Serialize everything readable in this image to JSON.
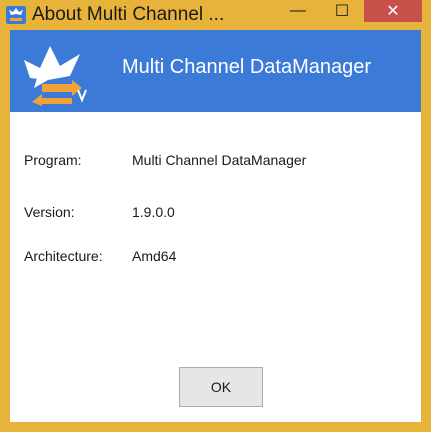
{
  "window": {
    "title": "About Multi Channel ...",
    "minimize_glyph": "—",
    "maximize_glyph": "☐",
    "close_glyph": "✕",
    "frame_color": "#e8b33a",
    "close_color": "#c7504b"
  },
  "banner": {
    "title": "Multi Channel DataManager",
    "background": "#3c7ad8",
    "logo_icon": "app-logo-icon"
  },
  "info": [
    {
      "label": "Program:",
      "value": "Multi Channel DataManager"
    },
    {
      "label": "Version:",
      "value": "1.9.0.0"
    },
    {
      "label": "Architecture:",
      "value": "Amd64"
    }
  ],
  "buttons": {
    "ok_label": "OK"
  }
}
